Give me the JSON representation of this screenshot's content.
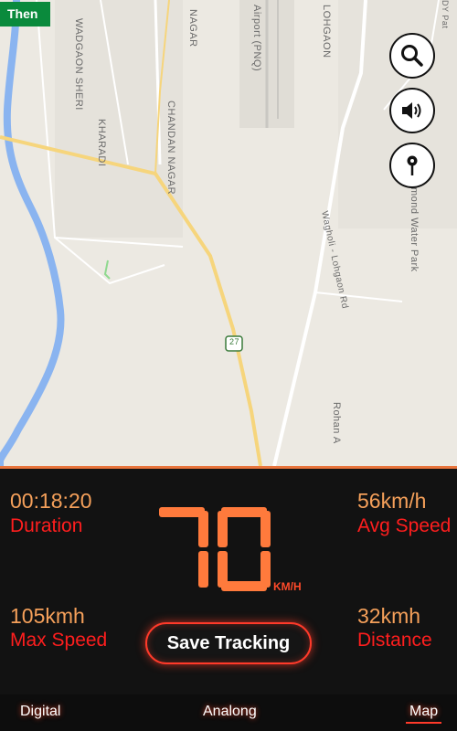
{
  "map": {
    "badge": "Then",
    "labels": {
      "wadgaon_sheri": "WADGAON SHERI",
      "kharadi": "KHARADI",
      "chandan_nagar": "CHANDAN NAGAR",
      "nagar": "NAGAR",
      "airport": "Airport (PNQ)",
      "lohgaon": "LOHGAON",
      "wagholi_road": "Wagholi - Lohgaon Rd",
      "water_park": "mond Water Park",
      "rohan": "Rohan A",
      "highway_shield": "27",
      "dy_pat": "DY Pat"
    },
    "buttons": {
      "search_icon": "search-icon",
      "volume_icon": "volume-icon",
      "location_icon": "location-pin-icon"
    }
  },
  "dashboard": {
    "duration_value": "00:18:20",
    "duration_label": "Duration",
    "avg_speed_value": "56km/h",
    "avg_speed_label": "Avg Speed",
    "max_speed_value": "105kmh",
    "max_speed_label": "Max Speed",
    "distance_value": "32kmh",
    "distance_label": "Distance",
    "speed": "70",
    "speed_unit": "KM/H",
    "save_button": "Save Tracking"
  },
  "nav": {
    "tabs": [
      {
        "label": "Digital",
        "active": false
      },
      {
        "label": "Analong",
        "active": false
      },
      {
        "label": "Map",
        "active": true
      }
    ]
  },
  "colors": {
    "accent": "#ff1e1e",
    "value": "#f5a05a",
    "speed_digit": "#ff7a3c",
    "badge": "#0a8a3c"
  }
}
